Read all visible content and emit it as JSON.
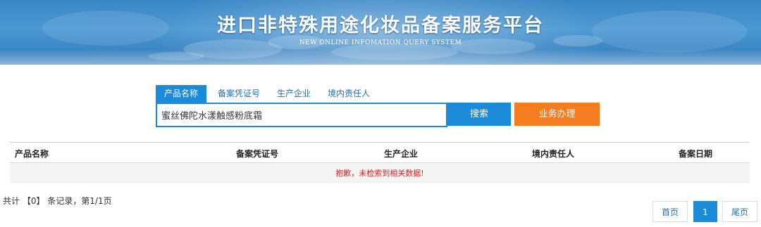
{
  "banner": {
    "title": "进口非特殊用途化妆品备案服务平台",
    "subtitle": "NEW ONLINE INFOMATION QUERY SYSTEM"
  },
  "search": {
    "tabs": [
      {
        "label": "产品名称",
        "active": true
      },
      {
        "label": "备案凭证号",
        "active": false
      },
      {
        "label": "生产企业",
        "active": false
      },
      {
        "label": "境内责任人",
        "active": false
      }
    ],
    "value": "蜜丝佛陀水漾触感粉底霜",
    "search_button": "搜索",
    "business_button": "业务办理"
  },
  "table": {
    "columns": [
      "产品名称",
      "备案凭证号",
      "生产企业",
      "境内责任人",
      "备案日期"
    ],
    "empty_message": "抱歉，未检索到相关数据!"
  },
  "pagination": {
    "summary": "共计 【0】 条记录，第1/1页",
    "first": "首页",
    "current": "1",
    "last": "尾页"
  },
  "colors": {
    "accent": "#1b8ad8",
    "business_button": "#f57c1f",
    "error_text": "#e02020"
  }
}
